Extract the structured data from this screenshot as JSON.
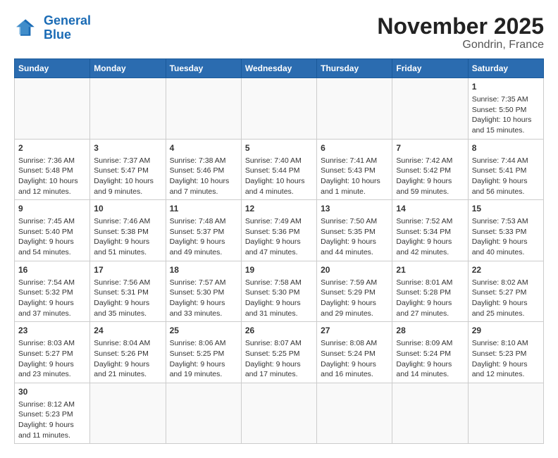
{
  "header": {
    "logo_general": "General",
    "logo_blue": "Blue",
    "title": "November 2025",
    "subtitle": "Gondrin, France"
  },
  "days_of_week": [
    "Sunday",
    "Monday",
    "Tuesday",
    "Wednesday",
    "Thursday",
    "Friday",
    "Saturday"
  ],
  "weeks": [
    [
      {
        "day": "",
        "content": ""
      },
      {
        "day": "",
        "content": ""
      },
      {
        "day": "",
        "content": ""
      },
      {
        "day": "",
        "content": ""
      },
      {
        "day": "",
        "content": ""
      },
      {
        "day": "",
        "content": ""
      },
      {
        "day": "1",
        "content": "Sunrise: 7:35 AM\nSunset: 5:50 PM\nDaylight: 10 hours and 15 minutes."
      }
    ],
    [
      {
        "day": "2",
        "content": "Sunrise: 7:36 AM\nSunset: 5:48 PM\nDaylight: 10 hours and 12 minutes."
      },
      {
        "day": "3",
        "content": "Sunrise: 7:37 AM\nSunset: 5:47 PM\nDaylight: 10 hours and 9 minutes."
      },
      {
        "day": "4",
        "content": "Sunrise: 7:38 AM\nSunset: 5:46 PM\nDaylight: 10 hours and 7 minutes."
      },
      {
        "day": "5",
        "content": "Sunrise: 7:40 AM\nSunset: 5:44 PM\nDaylight: 10 hours and 4 minutes."
      },
      {
        "day": "6",
        "content": "Sunrise: 7:41 AM\nSunset: 5:43 PM\nDaylight: 10 hours and 1 minute."
      },
      {
        "day": "7",
        "content": "Sunrise: 7:42 AM\nSunset: 5:42 PM\nDaylight: 9 hours and 59 minutes."
      },
      {
        "day": "8",
        "content": "Sunrise: 7:44 AM\nSunset: 5:41 PM\nDaylight: 9 hours and 56 minutes."
      }
    ],
    [
      {
        "day": "9",
        "content": "Sunrise: 7:45 AM\nSunset: 5:40 PM\nDaylight: 9 hours and 54 minutes."
      },
      {
        "day": "10",
        "content": "Sunrise: 7:46 AM\nSunset: 5:38 PM\nDaylight: 9 hours and 51 minutes."
      },
      {
        "day": "11",
        "content": "Sunrise: 7:48 AM\nSunset: 5:37 PM\nDaylight: 9 hours and 49 minutes."
      },
      {
        "day": "12",
        "content": "Sunrise: 7:49 AM\nSunset: 5:36 PM\nDaylight: 9 hours and 47 minutes."
      },
      {
        "day": "13",
        "content": "Sunrise: 7:50 AM\nSunset: 5:35 PM\nDaylight: 9 hours and 44 minutes."
      },
      {
        "day": "14",
        "content": "Sunrise: 7:52 AM\nSunset: 5:34 PM\nDaylight: 9 hours and 42 minutes."
      },
      {
        "day": "15",
        "content": "Sunrise: 7:53 AM\nSunset: 5:33 PM\nDaylight: 9 hours and 40 minutes."
      }
    ],
    [
      {
        "day": "16",
        "content": "Sunrise: 7:54 AM\nSunset: 5:32 PM\nDaylight: 9 hours and 37 minutes."
      },
      {
        "day": "17",
        "content": "Sunrise: 7:56 AM\nSunset: 5:31 PM\nDaylight: 9 hours and 35 minutes."
      },
      {
        "day": "18",
        "content": "Sunrise: 7:57 AM\nSunset: 5:30 PM\nDaylight: 9 hours and 33 minutes."
      },
      {
        "day": "19",
        "content": "Sunrise: 7:58 AM\nSunset: 5:30 PM\nDaylight: 9 hours and 31 minutes."
      },
      {
        "day": "20",
        "content": "Sunrise: 7:59 AM\nSunset: 5:29 PM\nDaylight: 9 hours and 29 minutes."
      },
      {
        "day": "21",
        "content": "Sunrise: 8:01 AM\nSunset: 5:28 PM\nDaylight: 9 hours and 27 minutes."
      },
      {
        "day": "22",
        "content": "Sunrise: 8:02 AM\nSunset: 5:27 PM\nDaylight: 9 hours and 25 minutes."
      }
    ],
    [
      {
        "day": "23",
        "content": "Sunrise: 8:03 AM\nSunset: 5:27 PM\nDaylight: 9 hours and 23 minutes."
      },
      {
        "day": "24",
        "content": "Sunrise: 8:04 AM\nSunset: 5:26 PM\nDaylight: 9 hours and 21 minutes."
      },
      {
        "day": "25",
        "content": "Sunrise: 8:06 AM\nSunset: 5:25 PM\nDaylight: 9 hours and 19 minutes."
      },
      {
        "day": "26",
        "content": "Sunrise: 8:07 AM\nSunset: 5:25 PM\nDaylight: 9 hours and 17 minutes."
      },
      {
        "day": "27",
        "content": "Sunrise: 8:08 AM\nSunset: 5:24 PM\nDaylight: 9 hours and 16 minutes."
      },
      {
        "day": "28",
        "content": "Sunrise: 8:09 AM\nSunset: 5:24 PM\nDaylight: 9 hours and 14 minutes."
      },
      {
        "day": "29",
        "content": "Sunrise: 8:10 AM\nSunset: 5:23 PM\nDaylight: 9 hours and 12 minutes."
      }
    ],
    [
      {
        "day": "30",
        "content": "Sunrise: 8:12 AM\nSunset: 5:23 PM\nDaylight: 9 hours and 11 minutes."
      },
      {
        "day": "",
        "content": ""
      },
      {
        "day": "",
        "content": ""
      },
      {
        "day": "",
        "content": ""
      },
      {
        "day": "",
        "content": ""
      },
      {
        "day": "",
        "content": ""
      },
      {
        "day": "",
        "content": ""
      }
    ]
  ]
}
